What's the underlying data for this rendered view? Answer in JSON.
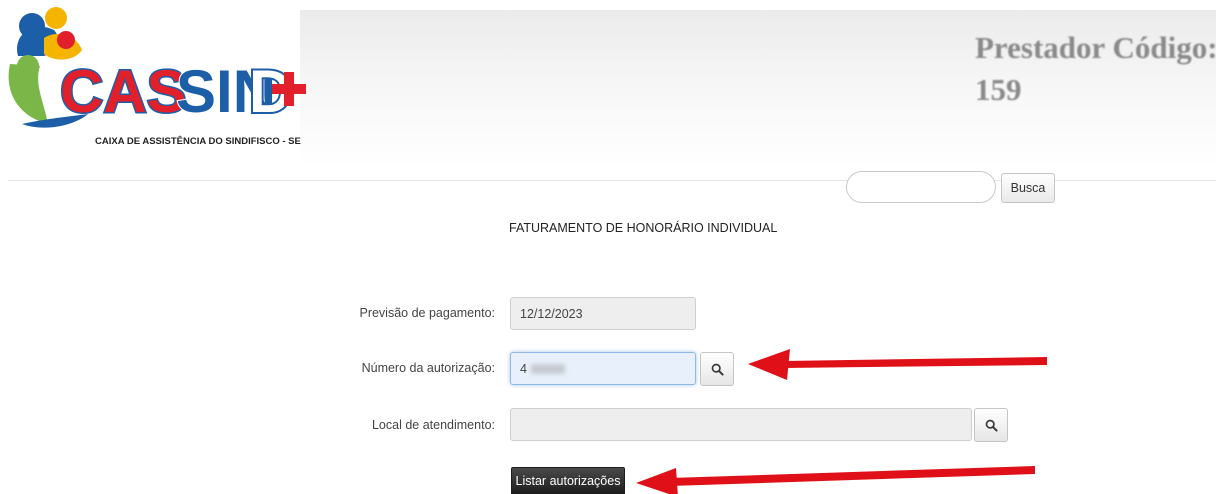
{
  "logo": {
    "text": "CASSIND",
    "subtitle": "CAIXA DE ASSISTÊNCIA DO SINDIFISCO - SE"
  },
  "header": {
    "prestador_label": "Prestador Código:",
    "prestador_code": "159"
  },
  "search": {
    "placeholder": "",
    "button_label": "Busca"
  },
  "page_title": "FATURAMENTO DE HONORÁRIO INDIVIDUAL",
  "form": {
    "previsao_label": "Previsão de pagamento:",
    "previsao_value": "12/12/2023",
    "numero_label": "Número da autorização:",
    "numero_value": "4",
    "local_label": "Local de atendimento:",
    "local_value": "",
    "list_button_label": "Listar autorizações"
  },
  "colors": {
    "logo_red": "#e2202b",
    "logo_blue": "#1c5ea8",
    "arrow_red": "#e01018",
    "button_dark": "#2a2a2a",
    "focus_blue": "#e8f1fb"
  },
  "icons": {
    "search_icon": "magnifier",
    "plus_icon": "plus-cross"
  }
}
